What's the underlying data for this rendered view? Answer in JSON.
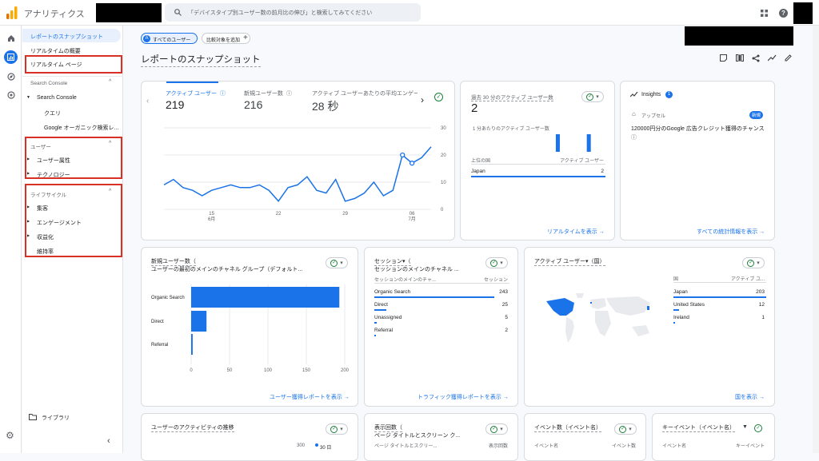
{
  "app": {
    "title": "アナリティクス"
  },
  "search": {
    "placeholder": "「デバイスタイプ別ユーザー数の前月比の伸び」と検索してみてください"
  },
  "icons": {
    "home": "home-icon",
    "reports": "reports-icon",
    "explore": "explore-icon",
    "advertising": "advertising-icon",
    "settings": "gear-icon",
    "apps": "apps-grid-icon",
    "help": "help-icon"
  },
  "colors": {
    "accent": "#1a73e8",
    "highlight_box": "#d93025",
    "logo_orange": "#f9ab00",
    "logo_dark": "#e37400"
  },
  "sidebar": {
    "snapshot": "レポートのスナップショット",
    "realtime_overview": "リアルタイムの概要",
    "realtime_page": "リアルタイム ページ",
    "search_console_section": "Search Console",
    "search_console": "Search Console",
    "queries": "クエリ",
    "google_organic": "Google オーガニック検索レ...",
    "user_section": "ユーザー",
    "user_attributes": "ユーザー属性",
    "technology": "テクノロジー",
    "lifecycle_section": "ライフサイクル",
    "acquisition": "集客",
    "engagement": "エンゲージメント",
    "monetization": "収益化",
    "retention": "維持率",
    "library": "ライブラリ"
  },
  "header": {
    "all_users": "すべてのユーザー",
    "add_comparison": "比較対象を追加",
    "page_title": "レポートのスナップショット"
  },
  "metrics": {
    "active_users_label": "アクティブ ユーザー",
    "active_users": "219",
    "new_users_label": "新規ユーザー数",
    "new_users": "216",
    "avg_engagement_label": "アクティブ ユーザーあたりの平均エンゲー",
    "avg_engagement": "28 秒"
  },
  "line_chart": {
    "type": "line",
    "x_ticks": [
      "15",
      "22",
      "29",
      "06"
    ],
    "x_months": [
      "6月",
      "",
      "",
      "7月"
    ],
    "y_ticks": [
      "30",
      "20",
      "10",
      "0"
    ],
    "ylim": [
      0,
      30
    ],
    "values": [
      9,
      11,
      8,
      7,
      5,
      7,
      8,
      9,
      8,
      8,
      9,
      7,
      3,
      8,
      9,
      12,
      7,
      6,
      11,
      3,
      4,
      6,
      10,
      5,
      7,
      20,
      17,
      19,
      23
    ]
  },
  "realtime": {
    "label": "過去 30 分のアクティブ ユーザー数",
    "value": "2",
    "per_min_label": "1 分あたりのアクティブ ユーザー数",
    "col1": "上位の国",
    "col2": "アクティブ ユーザー",
    "rows": [
      {
        "name": "Japan",
        "value": "2"
      }
    ],
    "link": "リアルタイムを表示",
    "bars": [
      {
        "minute": 13,
        "value": 1
      },
      {
        "minute": 20,
        "value": 1
      }
    ]
  },
  "insights": {
    "title": "Insights",
    "badge": "1",
    "category": "アップセル",
    "new": "新規",
    "text": "120000円分のGoogle 広告クレジット獲得のチャンス",
    "link": "すべての統計情報を表示"
  },
  "new_users_card": {
    "title": "新規ユーザー数（",
    "subtitle": "ユーザーの最初のメインのチャネル グループ（デフォルト...",
    "link": "ユーザー獲得レポートを表示",
    "chart_data": {
      "type": "bar",
      "categories": [
        "Organic Search",
        "Direct",
        "Referral"
      ],
      "values": [
        193,
        20,
        2
      ],
      "xlim": [
        0,
        200
      ],
      "x_ticks": [
        "0",
        "50",
        "100",
        "150",
        "200"
      ]
    }
  },
  "sessions_card": {
    "title": "セッション▾（",
    "subtitle": "セッションのメインのチャネル ...",
    "col1": "セッションのメインのチャ...",
    "col2": "セッション",
    "rows": [
      {
        "name": "Organic Search",
        "value": "243",
        "share": 1.0
      },
      {
        "name": "Direct",
        "value": "25",
        "share": 0.1
      },
      {
        "name": "Unassigned",
        "value": "5",
        "share": 0.02
      },
      {
        "name": "Referral",
        "value": "2",
        "share": 0.01
      }
    ],
    "link": "トラフィック獲得レポートを表示"
  },
  "country_card": {
    "title": "アクティブ ユーザー▾（国）",
    "col1": "国",
    "col2": "アクティブ ユ...",
    "rows": [
      {
        "name": "Japan",
        "value": "203",
        "share": 1.0
      },
      {
        "name": "United States",
        "value": "12",
        "share": 0.06
      },
      {
        "name": "Ireland",
        "value": "1",
        "share": 0.005
      }
    ],
    "link": "国を表示"
  },
  "bottom": {
    "activity_title": "ユーザーのアクティビティの推移",
    "activity_y": "300",
    "activity_legend": "30 日",
    "views_title": "表示回数（",
    "views_sub": "ページ タイトルとスクリーン ク...",
    "views_col1": "ページ タイトルとスクリー...",
    "views_col2": "表示回数",
    "events_title": "イベント数（イベント名）",
    "events_col1": "イベント名",
    "events_col2": "イベント数",
    "key_title": "キーイベント（イベント名）",
    "key_col1": "イベント名",
    "key_col2": "キーイベント"
  }
}
